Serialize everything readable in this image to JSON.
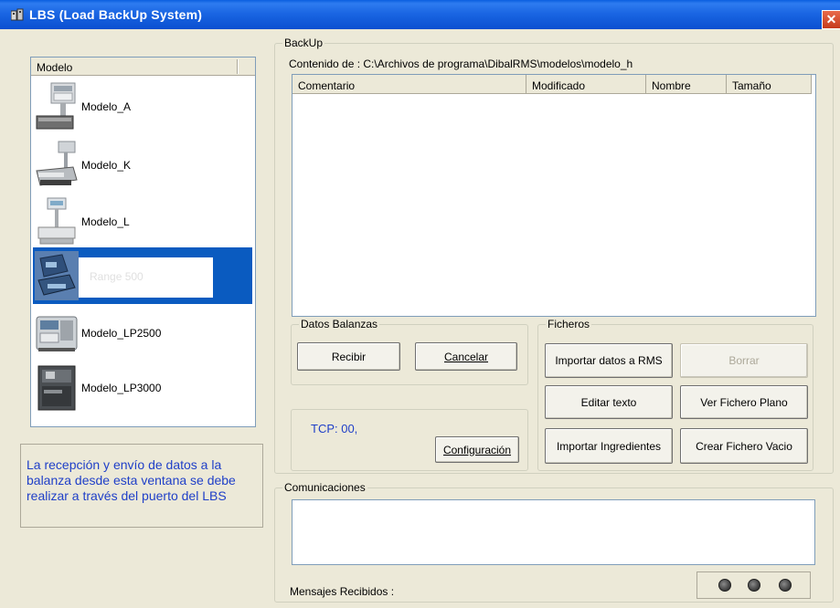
{
  "window": {
    "title": "LBS (Load BackUp System)",
    "close_glyph": "✕"
  },
  "models": {
    "header": "Modelo",
    "items": [
      {
        "label": "Modelo_A",
        "icon": "scale-a-icon"
      },
      {
        "label": "Modelo_K",
        "icon": "scale-k-icon"
      },
      {
        "label": "Modelo_L",
        "icon": "scale-l-icon"
      },
      {
        "label": "Range 500",
        "icon": "scale-range-icon",
        "selected": true
      },
      {
        "label": "Modelo_LP2500",
        "icon": "printer-lp2500-icon"
      },
      {
        "label": "Modelo_LP3000",
        "icon": "printer-lp3000-icon"
      }
    ]
  },
  "info": {
    "text": "La recepción y envío de datos a la balanza desde esta ventana se debe realizar a través del puerto del LBS"
  },
  "backup": {
    "group_label": "BackUp",
    "contenido": "Contenido de : C:\\Archivos de programa\\DibalRMS\\modelos\\modelo_h",
    "columns": [
      "Comentario",
      "Modificado",
      "Nombre",
      "Tamaño"
    ]
  },
  "datos_balanzas": {
    "group_label": "Datos Balanzas",
    "recibir": "Recibir",
    "cancelar": "Cancelar"
  },
  "tcp": {
    "status": "TCP: 00,",
    "config": "Configuración"
  },
  "ficheros": {
    "group_label": "Ficheros",
    "importar_rms": "Importar datos a RMS",
    "borrar": "Borrar",
    "editar_texto": "Editar texto",
    "ver_fichero": "Ver Fichero Plano",
    "importar_ingredientes": "Importar Ingredientes",
    "crear_fichero": "Crear Fichero Vacio"
  },
  "comunicaciones": {
    "group_label": "Comunicaciones",
    "mensajes_label": "Mensajes Recibidos :"
  },
  "colors": {
    "titlebar": "#0A5FE0",
    "selection": "#0A5BC0",
    "info_text": "#1F3FC8",
    "face": "#ECE9D8"
  }
}
